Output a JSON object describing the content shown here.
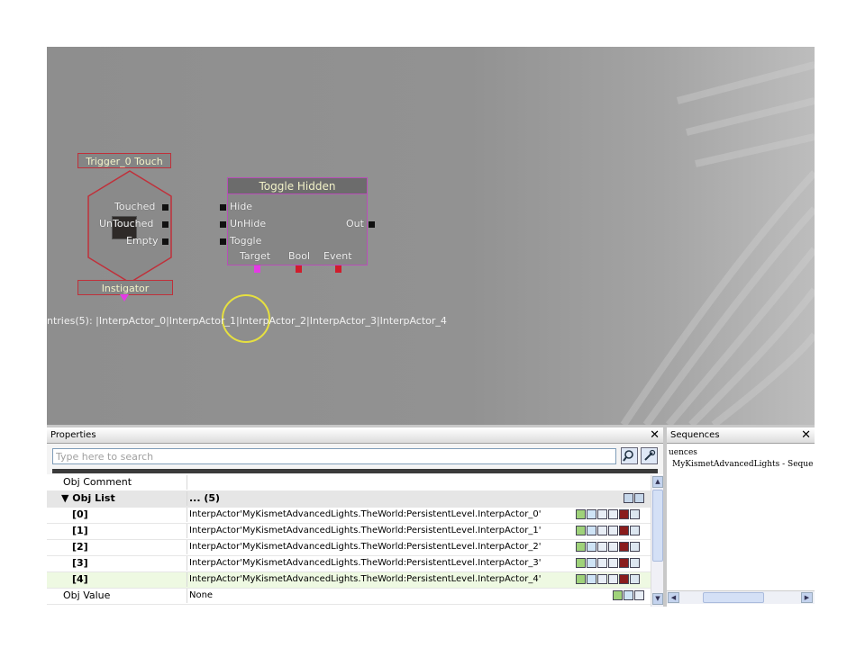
{
  "canvas": {
    "event_node": {
      "title": "Trigger_0 Touch",
      "outputs": [
        "Touched",
        "UnTouched",
        "Empty"
      ],
      "instigator": "Instigator"
    },
    "action_node": {
      "title": "Toggle Hidden",
      "inputs": [
        "Hide",
        "UnHide",
        "Toggle"
      ],
      "output": "Out",
      "variables": [
        "Target",
        "Bool",
        "Event"
      ]
    },
    "object_list_text": "ntries(5):   |InterpActor_0|InterpActor_1|InterpActor_2|InterpActor_3|InterpActor_4",
    "colors": {
      "event_border": "#c0303a",
      "action_border": "#b84eb8",
      "variable_outline": "#e6e040",
      "target_connector": "#e43be4",
      "bool_connector": "#d01c2c"
    }
  },
  "properties": {
    "title": "Properties",
    "close": "✕",
    "search_placeholder": "Type here to search",
    "search_icon": "magnifier-icon",
    "options_icon": "wrench-icon",
    "rows": [
      {
        "name": "Obj Comment",
        "value": "",
        "kind": "plain"
      },
      {
        "name": "▼ Obj List",
        "value": "... (5)",
        "kind": "category"
      },
      {
        "name": "[0]",
        "value": "InterpActor'MyKismetAdvancedLights.TheWorld:PersistentLevel.InterpActor_0'",
        "kind": "item"
      },
      {
        "name": "[1]",
        "value": "InterpActor'MyKismetAdvancedLights.TheWorld:PersistentLevel.InterpActor_1'",
        "kind": "item"
      },
      {
        "name": "[2]",
        "value": "InterpActor'MyKismetAdvancedLights.TheWorld:PersistentLevel.InterpActor_2'",
        "kind": "item"
      },
      {
        "name": "[3]",
        "value": "InterpActor'MyKismetAdvancedLights.TheWorld:PersistentLevel.InterpActor_3'",
        "kind": "item"
      },
      {
        "name": "[4]",
        "value": "InterpActor'MyKismetAdvancedLights.TheWorld:PersistentLevel.InterpActor_4'",
        "kind": "item-selected"
      },
      {
        "name": "Obj Value",
        "value": "None",
        "kind": "plain-tools"
      }
    ]
  },
  "sequences": {
    "title": "Sequences",
    "close": "✕",
    "tree": [
      "uences",
      "MyKismetAdvancedLights - Sequence"
    ]
  }
}
